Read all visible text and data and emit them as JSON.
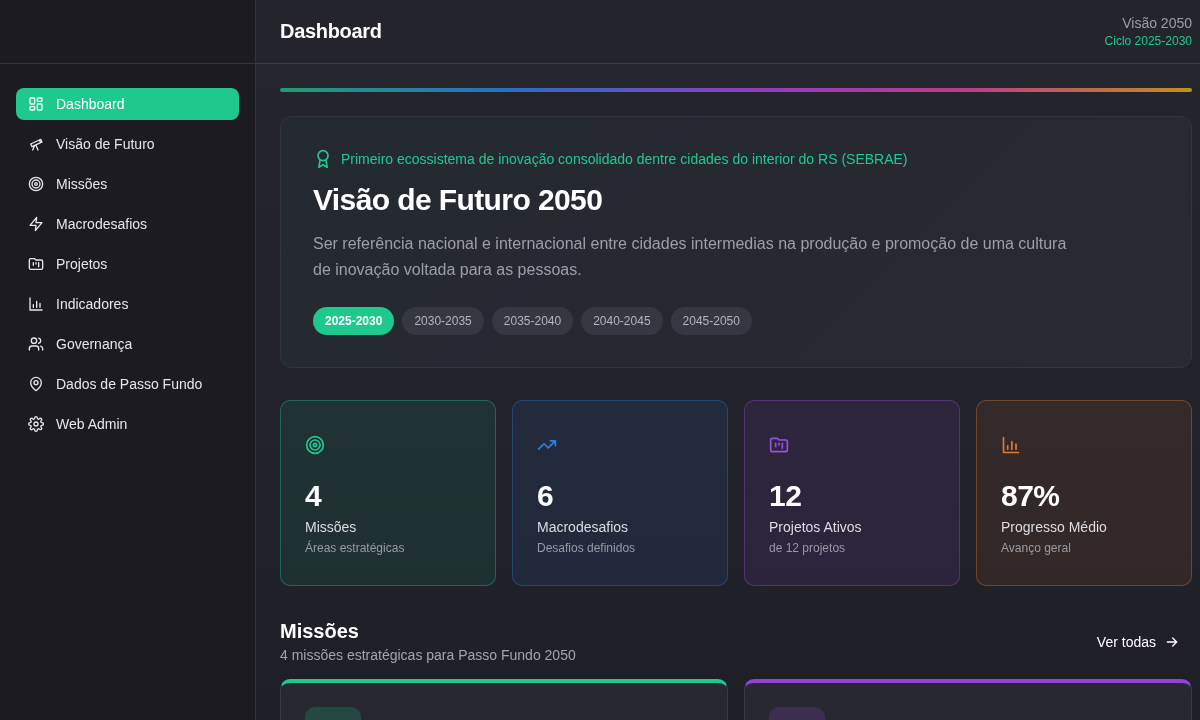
{
  "header": {
    "title": "Dashboard",
    "vision": "Visão 2050",
    "cycle": "Ciclo 2025-2030"
  },
  "sidebar": {
    "items": [
      {
        "label": "Dashboard",
        "kind": "grid",
        "selected": true
      },
      {
        "label": "Visão de Futuro",
        "kind": "telescope",
        "selected": false
      },
      {
        "label": "Missões",
        "kind": "target",
        "selected": false
      },
      {
        "label": "Macrodesafios",
        "kind": "zap",
        "selected": false
      },
      {
        "label": "Projetos",
        "kind": "folder",
        "selected": false
      },
      {
        "label": "Indicadores",
        "kind": "chart",
        "selected": false
      },
      {
        "label": "Governança",
        "kind": "users",
        "selected": false
      },
      {
        "label": "Dados de Passo Fundo",
        "kind": "pin",
        "selected": false
      },
      {
        "label": "Web Admin",
        "kind": "gear",
        "selected": false
      }
    ]
  },
  "hero": {
    "badge": "Primeiro ecossistema de inovação consolidado dentre cidades do interior do RS (SEBRAE)",
    "title": "Visão de Futuro 2050",
    "text": "Ser referência nacional e internacional entre cidades intermedias na produção e promoção de uma cultura de inovação voltada para as pessoas.",
    "periods": [
      {
        "label": "2025-2030",
        "selected": true
      },
      {
        "label": "2030-2035",
        "selected": false
      },
      {
        "label": "2035-2040",
        "selected": false
      },
      {
        "label": "2040-2045",
        "selected": false
      },
      {
        "label": "2045-2050",
        "selected": false
      }
    ]
  },
  "stats": [
    {
      "kind": "target",
      "color": "#1fc98e",
      "value": "4",
      "label": "Missões",
      "sub": "Áreas estratégicas"
    },
    {
      "kind": "trend",
      "color": "#2f7fe0",
      "value": "6",
      "label": "Macrodesafios",
      "sub": "Desafios definidos"
    },
    {
      "kind": "folder",
      "color": "#9a4fe0",
      "value": "12",
      "label": "Projetos Ativos",
      "sub": "de 12 projetos"
    },
    {
      "kind": "chart",
      "color": "#e07a2f",
      "value": "87%",
      "label": "Progresso Médio",
      "sub": "Avanço geral"
    }
  ],
  "missions": {
    "title": "Missões",
    "subtitle": "4 missões estratégicas para Passo Fundo 2050",
    "link": "Ver todas",
    "cards": [
      {
        "color": "#1fc98e"
      },
      {
        "color": "#8e44d6"
      }
    ]
  }
}
